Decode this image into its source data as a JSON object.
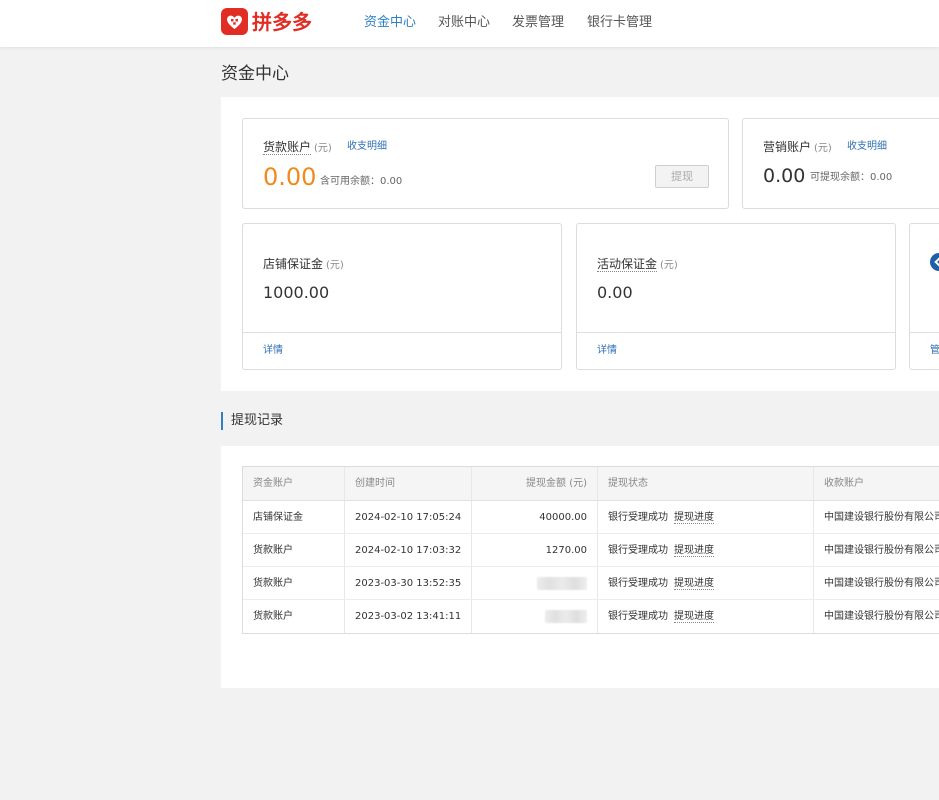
{
  "header": {
    "logo_text": "拼多多",
    "nav": [
      {
        "label": "资金中心",
        "active": true
      },
      {
        "label": "对账中心",
        "active": false
      },
      {
        "label": "发票管理",
        "active": false
      },
      {
        "label": "银行卡管理",
        "active": false
      }
    ]
  },
  "page_title": "资金中心",
  "accounts": {
    "goods": {
      "title": "货款账户",
      "unit": "(元)",
      "link": "收支明细",
      "amount": "0.00",
      "available": "含可用余额：0.00",
      "button": "提现"
    },
    "marketing": {
      "title": "营销账户",
      "unit": "(元)",
      "link": "收支明细",
      "amount": "0.00",
      "available": "可提现余额：0.00"
    }
  },
  "deposits": {
    "shop": {
      "title": "店铺保证金",
      "unit": "(元)",
      "amount": "1000.00",
      "link": "详情"
    },
    "activity": {
      "title": "活动保证金",
      "unit": "(元)",
      "amount": "0.00",
      "link": "详情"
    },
    "third": {
      "link": "管"
    }
  },
  "withdraw_section_title": "提现记录",
  "table": {
    "headers": [
      "资金账户",
      "创建时间",
      "提现金额 (元)",
      "提现状态",
      "收款账户"
    ],
    "progress_label": "提现进度",
    "rows": [
      {
        "account": "店铺保证金",
        "time": "2024-02-10 17:05:24",
        "amount": "40000.00",
        "status": "银行受理成功",
        "payee": "中国建设银行股份有限公司"
      },
      {
        "account": "货款账户",
        "time": "2024-02-10 17:03:32",
        "amount": "1270.00",
        "status": "银行受理成功",
        "payee": "中国建设银行股份有限公司"
      },
      {
        "account": "货款账户",
        "time": "2023-03-30 13:52:35",
        "amount": "",
        "status": "银行受理成功",
        "payee": "中国建设银行股份有限公司"
      },
      {
        "account": "货款账户",
        "time": "2023-03-02 13:41:11",
        "amount": "",
        "status": "银行受理成功",
        "payee": "中国建设银行股份有限公司"
      }
    ]
  },
  "colors": {
    "brand": "#e02e24",
    "accent": "#2f80c3",
    "amount_orange": "#f08a1c"
  }
}
